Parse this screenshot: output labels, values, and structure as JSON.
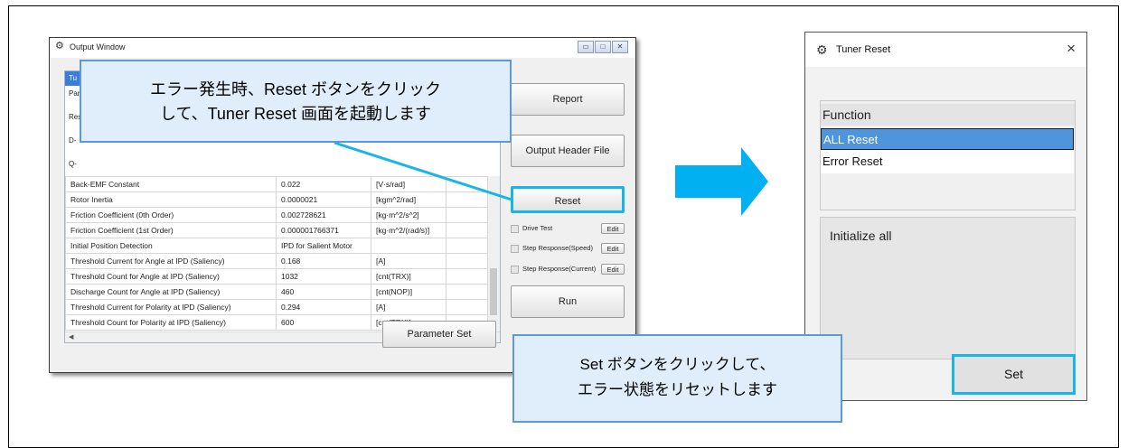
{
  "output_window": {
    "title": "Output Window",
    "header_cell": "Tu",
    "partial_rows": [
      "Par",
      "Res",
      "D-",
      "Q-"
    ],
    "rows": [
      [
        "Back-EMF Constant",
        "0.022",
        "[V·s/rad]"
      ],
      [
        "Rotor Inertia",
        "0.0000021",
        "[kgm^2/rad]"
      ],
      [
        "Friction Coefficient (0th Order)",
        "0.002728621",
        "[kg·m^2/s^2]"
      ],
      [
        "Friction Coefficient (1st Order)",
        "0.000001766371",
        "[kg·m^2/(rad/s)]"
      ],
      [
        "Initial Position Detection",
        "IPD for Salient Motor",
        ""
      ],
      [
        "Threshold Current for Angle at IPD (Saliency)",
        "0.168",
        "[A]"
      ],
      [
        "Threshold Count for Angle at IPD (Saliency)",
        "1032",
        "[cnt(TRX)]"
      ],
      [
        "Discharge Count for Angle at IPD (Saliency)",
        "460",
        "[cnt(NOP)]"
      ],
      [
        "Threshold Current for Polarity at IPD (Saliency)",
        "0.294",
        "[A]"
      ],
      [
        "Threshold Count for Polarity at IPD (Saliency)",
        "600",
        "[cnt(TRX)]"
      ]
    ],
    "buttons": {
      "report": "Report",
      "output_header": "Output Header File",
      "reset": "Reset",
      "run": "Run",
      "parameter_set": "Parameter Set"
    },
    "checks": [
      {
        "label": "Drive Test",
        "edit": "Edit"
      },
      {
        "label": "Step Response(Speed)",
        "edit": "Edit"
      },
      {
        "label": "Step Response(Current)",
        "edit": "Edit"
      }
    ]
  },
  "callout_reset": {
    "line1": "エラー発生時、Reset ボタンをクリック",
    "line2": "して、Tuner Reset 画面を起動します"
  },
  "callout_set": {
    "line1": "Set ボタンをクリックして、",
    "line2": "エラー状態をリセットします"
  },
  "tuner_reset": {
    "title": "Tuner Reset",
    "close": "×",
    "function_header": "Function",
    "items": [
      "ALL Reset",
      "Error Reset"
    ],
    "description": "Initialize all",
    "set_button": "Set"
  },
  "colors": {
    "highlight": "#19b5e8",
    "arrow": "#00b0f0",
    "callout_fill": "#dfeefa",
    "callout_border": "#5b9bd5",
    "selection": "#4f95de"
  }
}
